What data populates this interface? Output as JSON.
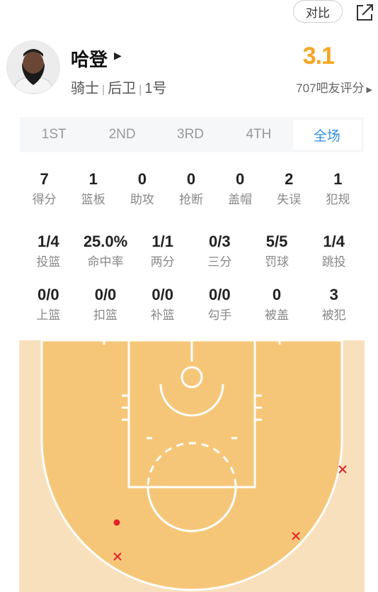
{
  "header": {
    "compare_label": "对比"
  },
  "player": {
    "name": "哈登",
    "team": "骑士",
    "position": "后卫",
    "number": "1号",
    "rating": "3.1",
    "rating_sub": "707吧友评分"
  },
  "tabs": [
    {
      "label": "1ST",
      "active": false
    },
    {
      "label": "2ND",
      "active": false
    },
    {
      "label": "3RD",
      "active": false
    },
    {
      "label": "4TH",
      "active": false
    },
    {
      "label": "全场",
      "active": true
    }
  ],
  "stats_row1": [
    {
      "value": "7",
      "label": "得分"
    },
    {
      "value": "1",
      "label": "篮板"
    },
    {
      "value": "0",
      "label": "助攻"
    },
    {
      "value": "0",
      "label": "抢断"
    },
    {
      "value": "0",
      "label": "盖帽"
    },
    {
      "value": "2",
      "label": "失误"
    },
    {
      "value": "1",
      "label": "犯规"
    }
  ],
  "stats_row2": [
    {
      "value": "1/4",
      "label": "投篮"
    },
    {
      "value": "25.0%",
      "label": "命中率"
    },
    {
      "value": "1/1",
      "label": "两分"
    },
    {
      "value": "0/3",
      "label": "三分"
    },
    {
      "value": "5/5",
      "label": "罚球"
    },
    {
      "value": "1/4",
      "label": "跳投"
    }
  ],
  "stats_row3": [
    {
      "value": "0/0",
      "label": "上篮"
    },
    {
      "value": "0/0",
      "label": "扣篮"
    },
    {
      "value": "0/0",
      "label": "补篮"
    },
    {
      "value": "0/0",
      "label": "勾手"
    },
    {
      "value": "0",
      "label": "被盖"
    },
    {
      "value": "3",
      "label": "被犯"
    }
  ],
  "colors": {
    "rating": "#f5a623",
    "active_tab": "#2f8fe6",
    "court_inner": "#f6c678",
    "court_outer": "#f9e0bd",
    "shot_mark": "#e0252a"
  }
}
